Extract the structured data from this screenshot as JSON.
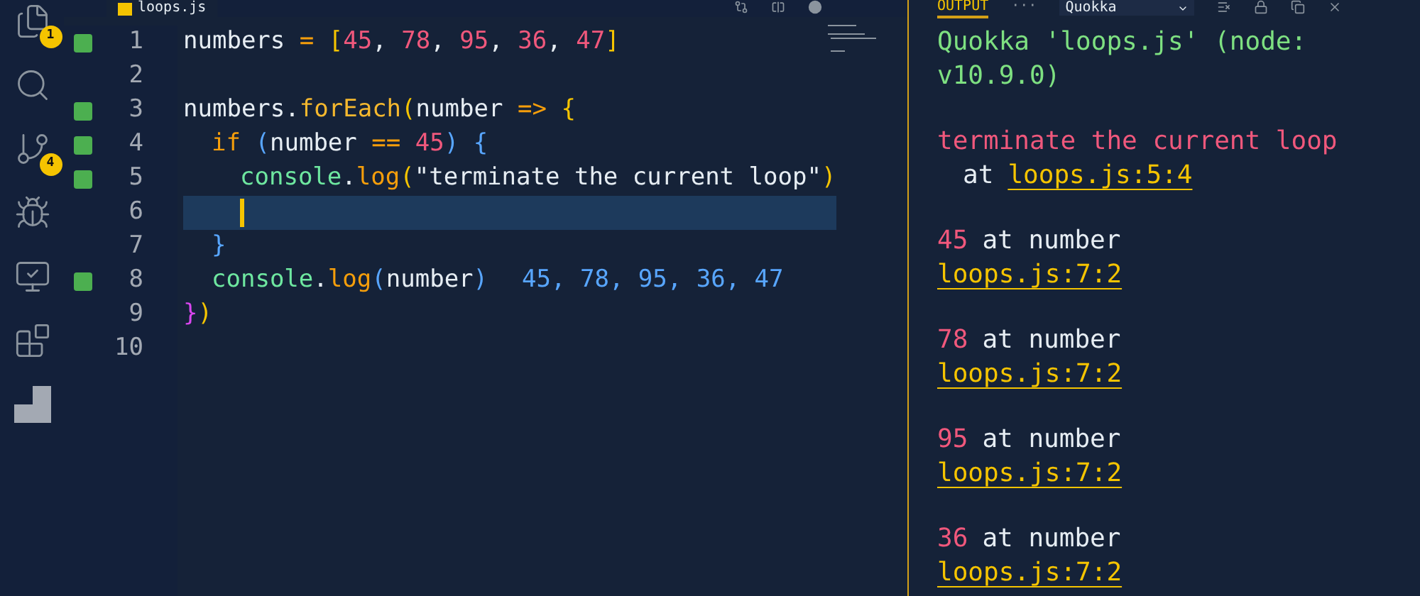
{
  "activity_bar": [
    {
      "kind": "files",
      "badge": "1"
    },
    {
      "kind": "search"
    },
    {
      "kind": "git",
      "badge": "4"
    },
    {
      "kind": "debug"
    },
    {
      "kind": "remote"
    },
    {
      "kind": "extensions"
    },
    {
      "kind": "quokka"
    }
  ],
  "editor": {
    "tab": {
      "label": "loops.js",
      "selected": true
    },
    "lines": [
      {
        "number": "1",
        "covered": true,
        "selected": false,
        "tokens": [
          {
            "t": "numbers",
            "color": "#e6edf3"
          },
          {
            "t": "=",
            "color": "#f59e0b"
          },
          {
            "t": "[",
            "color": "#f5c400"
          },
          {
            "t": "45",
            "color": "#f0587c"
          },
          {
            "t": ",",
            "color": "#e6edf3"
          },
          {
            "t": "78",
            "color": "#f0587c"
          },
          {
            "t": ",",
            "color": "#e6edf3"
          },
          {
            "t": "95",
            "color": "#f0587c"
          },
          {
            "t": ",",
            "color": "#e6edf3"
          },
          {
            "t": "36",
            "color": "#f0587c"
          },
          {
            "t": ",",
            "color": "#e6edf3"
          },
          {
            "t": "47",
            "color": "#f0587c"
          },
          {
            "t": "]",
            "color": "#f5c400"
          }
        ]
      },
      {
        "number": "2",
        "covered": false,
        "selected": false
      },
      {
        "number": "3",
        "covered": true,
        "selected": false,
        "tokens": [
          {
            "t": "numbers.",
            "color": "#e6edf3"
          },
          {
            "t": "forEach",
            "color": "#f5b82e"
          },
          {
            "t": "(",
            "color": "#f5c400"
          },
          {
            "t": "number",
            "color": "#e6edf3"
          },
          {
            "t": "=>",
            "color": "#f59e0b"
          },
          {
            "t": "{",
            "color": "#f5c400"
          }
        ],
        "children": [
          {
            "number": "4",
            "covered": true,
            "selected": false,
            "tokens": [
              {
                "t": "if",
                "color": "#f59e0b"
              },
              {
                "t": "(",
                "color": "#58a6ff"
              },
              {
                "t": "number",
                "color": "#e6edf3"
              },
              {
                "t": "==",
                "color": "#f59e0b"
              },
              {
                "t": "45",
                "color": "#f0587c"
              },
              {
                "t": ")",
                "color": "#58a6ff"
              },
              {
                "t": "{",
                "color": "#58a6ff"
              }
            ],
            "children": [
              {
                "number": "5",
                "covered": true,
                "selected": false,
                "tokens": [
                  {
                    "t": "console",
                    "color": "#6ee7a0"
                  },
                  {
                    "t": ".",
                    "color": "#e6edf3"
                  },
                  {
                    "t": "log",
                    "color": "#f59e0b"
                  },
                  {
                    "t": "(",
                    "color": "#f5c400"
                  },
                  {
                    "t": "\"terminate the current loop\"",
                    "color": "#e6edf3"
                  },
                  {
                    "t": ")",
                    "color": "#f5c400"
                  }
                ]
              },
              {
                "number": "6",
                "covered": false,
                "selected": true
              }
            ]
          },
          {
            "number": "7",
            "covered": false,
            "selected": false,
            "tokens": [
              {
                "t": "}",
                "color": "#58a6ff"
              }
            ]
          },
          {
            "number": "8",
            "covered": true,
            "selected": false,
            "tokens": [
              {
                "t": "console",
                "color": "#6ee7a0"
              },
              {
                "t": ".",
                "color": "#e6edf3"
              },
              {
                "t": "log",
                "color": "#f59e0b"
              },
              {
                "t": "(",
                "color": "#58a6ff"
              },
              {
                "t": "number",
                "color": "#e6edf3"
              },
              {
                "t": ")",
                "color": "#58a6ff"
              }
            ],
            "inline_value": "45, 78, 95, 36, 47"
          }
        ]
      },
      {
        "number": "9",
        "covered": false,
        "selected": false,
        "tokens": [
          {
            "t": "}",
            "color": "#d946ef"
          },
          {
            "t": ")",
            "color": "#f5c400"
          }
        ]
      },
      {
        "number": "10",
        "covered": false,
        "selected": false
      }
    ]
  },
  "output": {
    "tab": {
      "label": "OUTPUT",
      "selected": true
    },
    "more": "···",
    "channel": "Quokka",
    "entries": [
      {
        "kind": "header",
        "text": "Quokka 'loops.js' (node: v10.9.0)"
      },
      {
        "kind": "error",
        "text": "terminate the current loop",
        "at": "at",
        "location": "loops.js:5:4"
      },
      {
        "kind": "log",
        "value": "45",
        "text": "at number",
        "location": "loops.js:7:2"
      },
      {
        "kind": "log",
        "value": "78",
        "text": "at number",
        "location": "loops.js:7:2"
      },
      {
        "kind": "log",
        "value": "95",
        "text": "at number",
        "location": "loops.js:7:2"
      },
      {
        "kind": "log",
        "value": "36",
        "text": "at number",
        "location": "loops.js:7:2"
      }
    ]
  }
}
